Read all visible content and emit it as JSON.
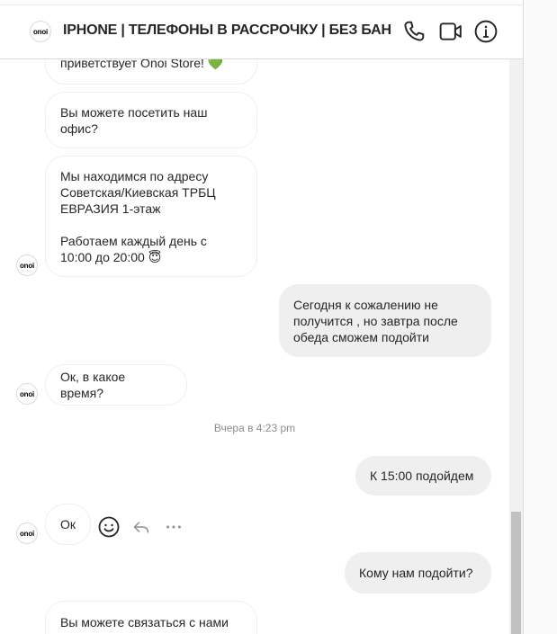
{
  "header": {
    "avatar_text": "onoi",
    "title": "IPHONE | ТЕЛЕФОНЫ В РАССРОЧКУ | БЕЗ БАНКА",
    "icons": [
      "phone-icon",
      "video-camera-icon",
      "info-icon"
    ]
  },
  "messages": {
    "m1": "приветствует Onoi Store! 💚",
    "m2": "Вы можете посетить наш\nофис?",
    "m3": "Мы находимся по адресу\nСоветская/Киевская ТРБЦ\nЕВРАЗИЯ 1-этаж\n\nРаботаем каждый день с\n10:00 до 20:00 😇",
    "m4": "Сегодня к сожалению не\nполучится , но завтра после\nобеда сможем подойти",
    "m5": "Ок, в какое время?",
    "m6": "К 15:00 подойдем",
    "m7": "Ок",
    "m8": "Кому нам подойти?",
    "m9": "Вы можете связаться с нами"
  },
  "timestamp": "Вчера в 4:23 pm",
  "avatar_text": "onoi",
  "actions": [
    "smiley-icon",
    "reply-icon",
    "more-icon"
  ]
}
